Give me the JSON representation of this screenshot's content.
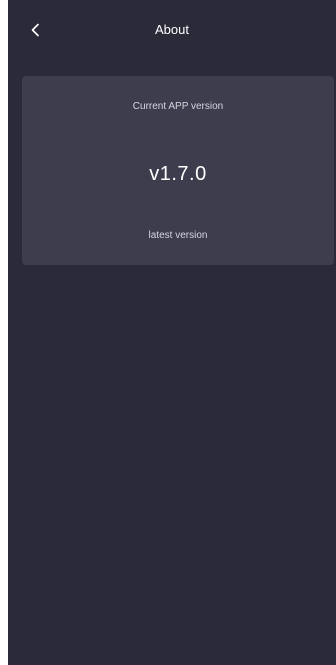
{
  "header": {
    "title": "About",
    "back_icon": "chevron-left-icon"
  },
  "version_card": {
    "label": "Current APP version",
    "version": "v1.7.0",
    "status": "latest version"
  },
  "colors": {
    "background": "#2b2a38",
    "card": "#3d3d4d",
    "text_primary": "#ffffff",
    "text_secondary": "#d6d6e0"
  }
}
